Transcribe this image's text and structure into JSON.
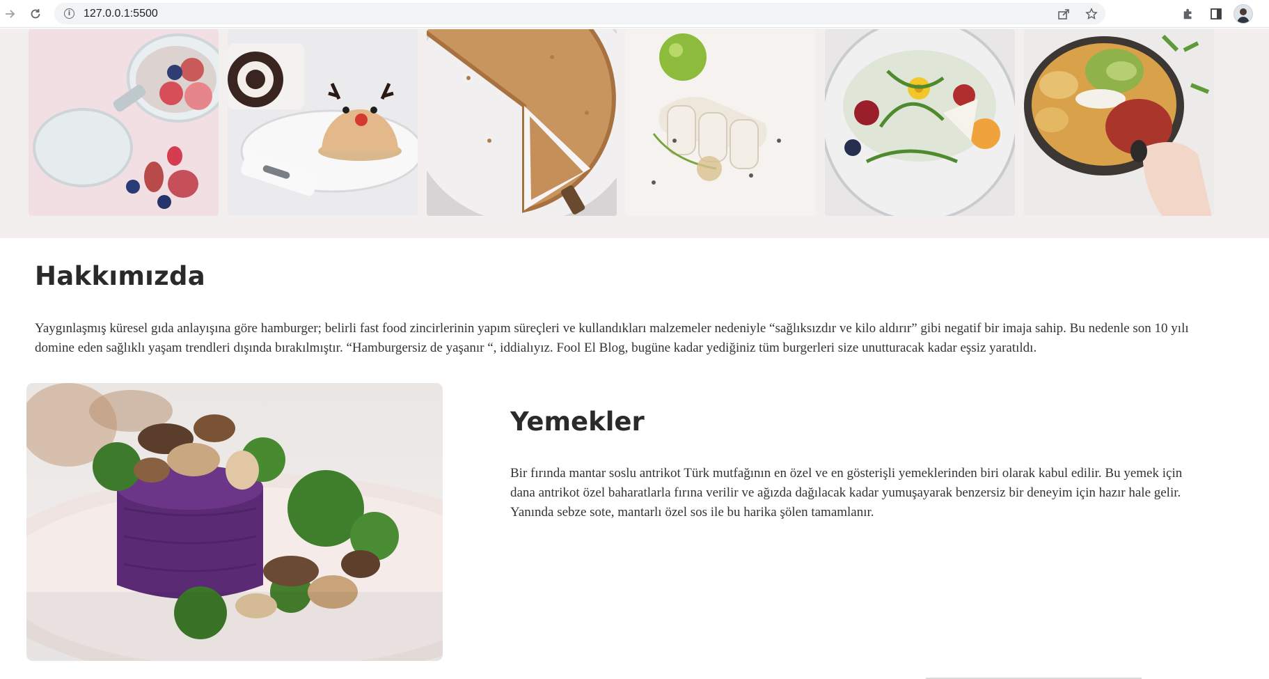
{
  "browser": {
    "url": "127.0.0.1:5500",
    "icons": [
      "forward-arrow-icon",
      "reload-icon",
      "info-icon",
      "share-icon",
      "bookmark-star-icon",
      "extensions-puzzle-icon",
      "side-panel-icon",
      "profile-avatar"
    ]
  },
  "gallery": {
    "images": [
      {
        "name": "fig-chia-pudding-image",
        "background": "#f1dfe3"
      },
      {
        "name": "swiss-roll-reindeer-cake-image",
        "background": "#ebebed"
      },
      {
        "name": "pie-slice-image",
        "background": "#d7d4d5"
      },
      {
        "name": "lime-fish-appetizer-image",
        "background": "#f5f2ef"
      },
      {
        "name": "salad-bowl-image",
        "background": "#e8e6e6"
      },
      {
        "name": "avocado-bowl-image",
        "background": "#ecebea"
      }
    ]
  },
  "about": {
    "title": "Hakkımızda",
    "text": "Yaygınlaşmış küresel gıda anlayışına göre hamburger; belirli fast food zincirlerinin yapım süreçleri ve kullandıkları malzemeler nedeniyle “sağlıksızdır ve kilo aldırır” gibi negatif bir imaja sahip. Bu nedenle son 10 yılı domine eden sağlıklı yaşam trendleri dışında bırakılmıştır. “Hamburgersiz de yaşanır “, iddialıyız. Fool El Blog, bugüne kadar yediğiniz tüm burgerleri size unutturacak kadar eşsiz yaratıldı."
  },
  "food": {
    "title": "Yemekler",
    "text": "Bir fırında mantar soslu antrikot Türk mutfağının en özel ve en gösterişli yemeklerinden biri olarak kabul edilir. Bu yemek için dana antrikot özel baharatlarla fırına verilir ve ağızda dağılacak kadar yumuşayarak benzersiz bir deneyim için hazır hale gelir. Yanında sebze sote, mantarlı özel sos ile bu harika şölen tamamlanır."
  },
  "colors": {
    "gallery_band": "#f3efee",
    "heading": "#2a2a2a",
    "body_text": "#333333"
  }
}
